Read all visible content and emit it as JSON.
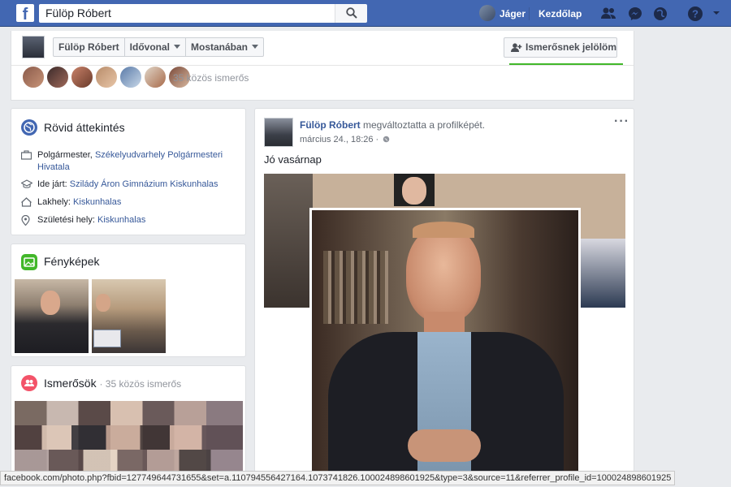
{
  "topbar": {
    "logo": "f",
    "search_value": "Fülöp Róbert",
    "user_name": "Jáger",
    "home_label": "Kezdőlap",
    "icons": [
      "search-icon",
      "friend-requests-icon",
      "messenger-icon",
      "notifications-icon",
      "help-icon",
      "account-menu-icon"
    ]
  },
  "profile_header": {
    "name_crumb": "Fülöp Róbert",
    "timeline_crumb": "Idővonal",
    "recent_crumb": "Mostanában",
    "add_friend_label": "Ismerősnek jelölöm",
    "mutual_friends_text": "35 közös ismerős"
  },
  "intro": {
    "title": "Rövid áttekintés",
    "work_label": "Polgármester,",
    "work_place": "Székelyudvarhely Polgármesteri Hivatala",
    "school_label": "Ide járt:",
    "school_name": "Szilády Áron Gimnázium Kiskunhalas",
    "lives_label": "Lakhely:",
    "lives_place": "Kiskunhalas",
    "born_label": "Születési hely:",
    "born_place": "Kiskunhalas"
  },
  "photos": {
    "title": "Fényképek"
  },
  "friends": {
    "title": "Ismerősök",
    "mutual": "· 35 közös ismerős"
  },
  "post": {
    "author": "Fülöp Róbert",
    "action": "megváltoztatta a profilképét.",
    "timestamp": "március 24., 18:26 ·",
    "text": "Jó vasárnap",
    "more": "···"
  },
  "statusbar": {
    "url": "facebook.com/photo.php?fbid=127749644731655&set=a.110794556427164.1073741826.100024898601925&type=3&source=11&referrer_profile_id=100024898601925"
  },
  "colors": {
    "brand_blue": "#4267b2",
    "link_blue": "#365899",
    "page_bg": "#e9ebee",
    "add_friend_green": "#42b72a"
  }
}
